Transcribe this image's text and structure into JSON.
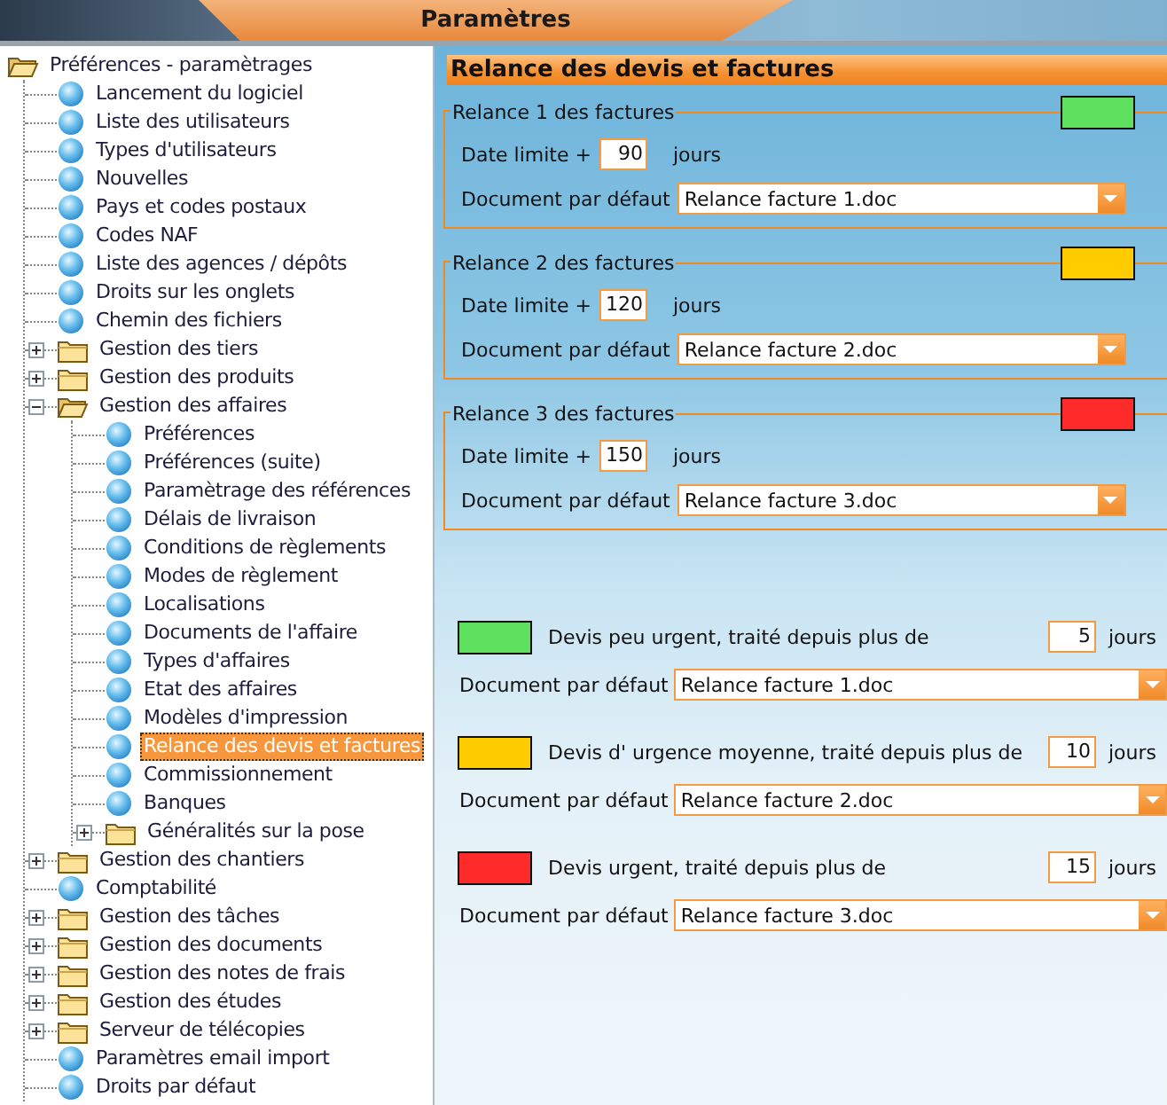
{
  "title": "Paramètres",
  "tree": [
    {
      "label": "Préférences - paramètrages",
      "kind": "folder",
      "expanded": true,
      "selected": false,
      "children": [
        {
          "label": "Lancement du logiciel",
          "kind": "leaf",
          "selected": false
        },
        {
          "label": "Liste des utilisateurs",
          "kind": "leaf",
          "selected": false
        },
        {
          "label": "Types d'utilisateurs",
          "kind": "leaf",
          "selected": false
        },
        {
          "label": "Nouvelles",
          "kind": "leaf",
          "selected": false
        },
        {
          "label": "Pays et codes postaux",
          "kind": "leaf",
          "selected": false
        },
        {
          "label": "Codes NAF",
          "kind": "leaf",
          "selected": false
        },
        {
          "label": "Liste des agences / dépôts",
          "kind": "leaf",
          "selected": false
        },
        {
          "label": "Droits sur les onglets",
          "kind": "leaf",
          "selected": false
        },
        {
          "label": "Chemin des fichiers",
          "kind": "leaf",
          "selected": false
        },
        {
          "label": "Gestion des tiers",
          "kind": "folder",
          "expanded": false,
          "selected": false
        },
        {
          "label": "Gestion des produits",
          "kind": "folder",
          "expanded": false,
          "selected": false
        },
        {
          "label": "Gestion des affaires",
          "kind": "folder",
          "expanded": true,
          "selected": false,
          "children": [
            {
              "label": "Préférences",
              "kind": "leaf",
              "selected": false
            },
            {
              "label": "Préférences (suite)",
              "kind": "leaf",
              "selected": false
            },
            {
              "label": "Paramètrage des références",
              "kind": "leaf",
              "selected": false
            },
            {
              "label": "Délais de livraison",
              "kind": "leaf",
              "selected": false
            },
            {
              "label": "Conditions de règlements",
              "kind": "leaf",
              "selected": false
            },
            {
              "label": "Modes de règlement",
              "kind": "leaf",
              "selected": false
            },
            {
              "label": "Localisations",
              "kind": "leaf",
              "selected": false
            },
            {
              "label": "Documents de l'affaire",
              "kind": "leaf",
              "selected": false
            },
            {
              "label": "Types d'affaires",
              "kind": "leaf",
              "selected": false
            },
            {
              "label": "Etat des affaires",
              "kind": "leaf",
              "selected": false
            },
            {
              "label": "Modèles d'impression",
              "kind": "leaf",
              "selected": false
            },
            {
              "label": "Relance des devis et factures",
              "kind": "leaf",
              "selected": true
            },
            {
              "label": "Commissionnement",
              "kind": "leaf",
              "selected": false
            },
            {
              "label": "Banques",
              "kind": "leaf",
              "selected": false
            },
            {
              "label": "Généralités sur la pose",
              "kind": "folder",
              "expanded": false,
              "selected": false
            }
          ]
        },
        {
          "label": "Gestion des chantiers",
          "kind": "folder",
          "expanded": false,
          "selected": false
        },
        {
          "label": "Comptabilité",
          "kind": "leaf",
          "selected": false
        },
        {
          "label": "Gestion des tâches",
          "kind": "folder",
          "expanded": false,
          "selected": false
        },
        {
          "label": "Gestion des documents",
          "kind": "folder",
          "expanded": false,
          "selected": false
        },
        {
          "label": "Gestion des notes de frais",
          "kind": "folder",
          "expanded": false,
          "selected": false
        },
        {
          "label": "Gestion des études",
          "kind": "folder",
          "expanded": false,
          "selected": false
        },
        {
          "label": "Serveur de télécopies",
          "kind": "folder",
          "expanded": false,
          "selected": false
        },
        {
          "label": "Paramètres email import",
          "kind": "leaf",
          "selected": false
        },
        {
          "label": "Droits par défaut",
          "kind": "leaf",
          "selected": false
        }
      ]
    }
  ],
  "panel": {
    "heading": "Relance des devis et factures",
    "reminders": [
      {
        "legend": "Relance 1 des factures",
        "color": "#5ee05e",
        "date_label": "Date limite +",
        "days": "90",
        "unit": "jours",
        "document_label": "Document par défaut",
        "document": "Relance facture 1.doc"
      },
      {
        "legend": "Relance 2 des factures",
        "color": "#ffcc00",
        "date_label": "Date limite +",
        "days": "120",
        "unit": "jours",
        "document_label": "Document par défaut",
        "document": "Relance facture 2.doc"
      },
      {
        "legend": "Relance 3 des factures",
        "color": "#ff2a2a",
        "date_label": "Date limite +",
        "days": "150",
        "unit": "jours",
        "document_label": "Document par défaut",
        "document": "Relance facture 3.doc"
      }
    ],
    "urgencies": [
      {
        "color": "#5ee05e",
        "label": "Devis peu urgent, traité depuis plus de",
        "days": "5",
        "unit": "jours",
        "document_label": "Document par défaut",
        "document": "Relance facture 1.doc"
      },
      {
        "color": "#ffcc00",
        "label": "Devis d' urgence moyenne, traité depuis plus de",
        "days": "10",
        "unit": "jours",
        "document_label": "Document par défaut",
        "document": "Relance facture 2.doc"
      },
      {
        "color": "#ff2a2a",
        "label": "Devis urgent, traité depuis plus de",
        "days": "15",
        "unit": "jours",
        "document_label": "Document par défaut",
        "document": "Relance facture 3.doc"
      }
    ]
  }
}
